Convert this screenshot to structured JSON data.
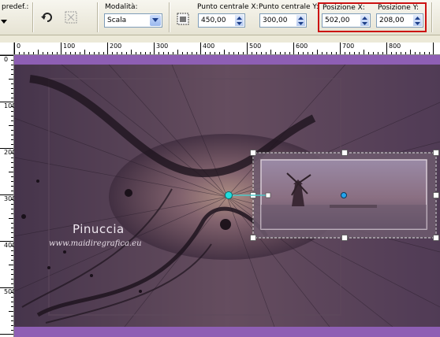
{
  "toolbar": {
    "preset_label": "predef.:",
    "mode_label": "Modalità:",
    "mode_value": "Scala",
    "center_x_label": "Punto centrale X:",
    "center_x_value": "450,00",
    "center_y_label": "Punto centrale Y:",
    "center_y_value": "300,00",
    "pos_x_label": "Posizione X:",
    "pos_x_value": "502,00",
    "pos_y_label": "Posizione Y:",
    "pos_y_value": "208,00"
  },
  "ruler": {
    "h_labels": [
      "0",
      "100",
      "200",
      "300",
      "400",
      "500",
      "600",
      "700",
      "800"
    ],
    "v_labels": [
      "0",
      "100",
      "200",
      "300",
      "400",
      "500"
    ]
  },
  "canvas": {
    "watermark_name": "Pinuccia",
    "watermark_url": "www.maidiregrafica.eu"
  },
  "colors": {
    "toolbar_bg": "#ece9d8",
    "canvas_purple": "#8e5fb4",
    "highlight_red": "#cc1111",
    "handle_cyan": "#22dddd"
  }
}
